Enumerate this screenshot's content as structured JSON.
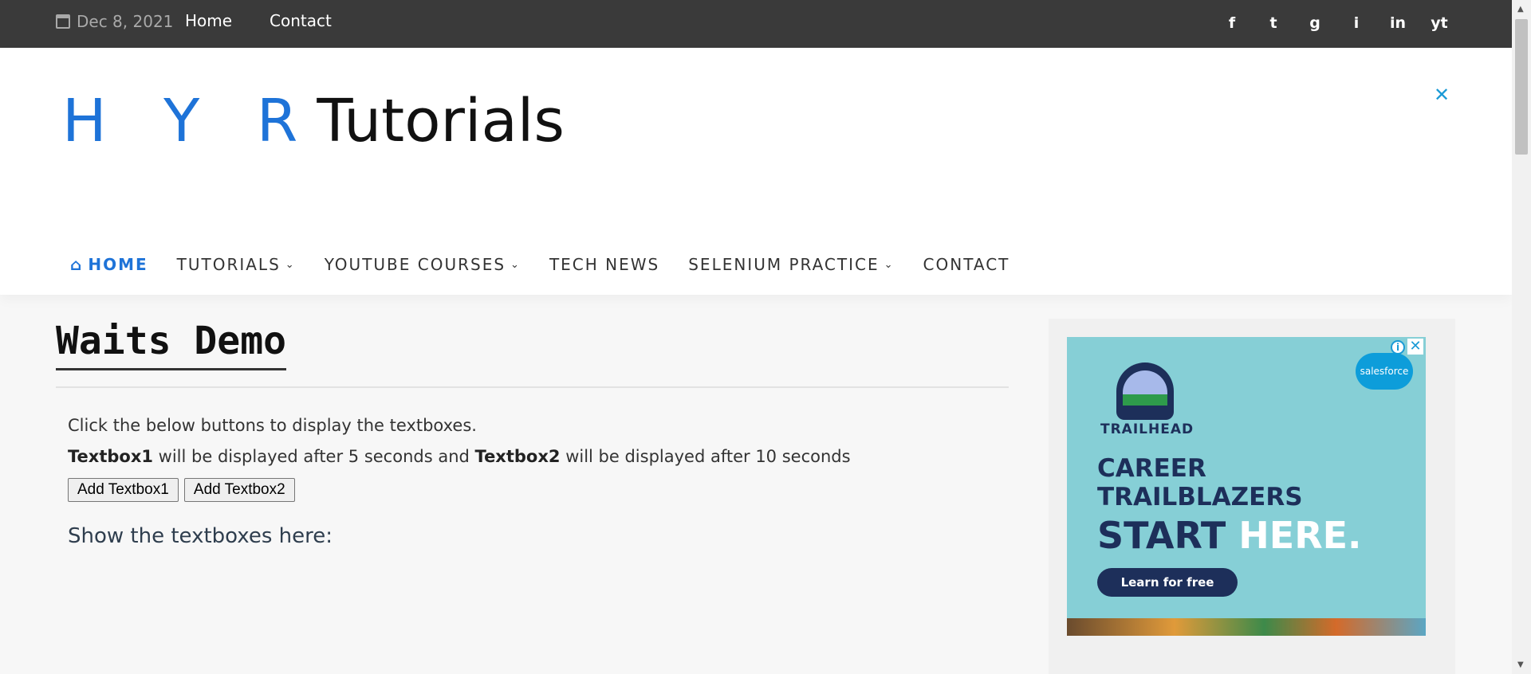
{
  "topbar": {
    "date": "Dec 8, 2021",
    "links": [
      "Home",
      "Contact"
    ],
    "social": [
      "f",
      "t",
      "g",
      "i",
      "in",
      "yt"
    ]
  },
  "header": {
    "logo_blue": "H Y R",
    "logo_black": "Tutorials",
    "ad_close": "✕"
  },
  "nav": {
    "items": [
      {
        "label": "HOME",
        "active": true
      },
      {
        "label": "TUTORIALS",
        "dropdown": true
      },
      {
        "label": "YOUTUBE COURSES",
        "dropdown": true
      },
      {
        "label": "TECH NEWS"
      },
      {
        "label": "SELENIUM PRACTICE",
        "dropdown": true
      },
      {
        "label": "CONTACT"
      }
    ]
  },
  "main": {
    "title": "Waits Demo",
    "instruction": "Click the below buttons to display the textboxes.",
    "desc_bold1": "Textbox1",
    "desc_mid": " will be displayed after 5 seconds and ",
    "desc_bold2": "Textbox2",
    "desc_end": " will be displayed after 10 seconds",
    "btn1": "Add Textbox1",
    "btn2": "Add Textbox2",
    "show_label": "Show the textboxes here:"
  },
  "ad": {
    "brand": "TRAILHEAD",
    "salesforce": "salesforce",
    "headline1": "CAREER",
    "headline2": "TRAILBLAZERS",
    "headline3a": "START",
    "headline3b": "HERE.",
    "cta": "Learn for free"
  },
  "colors": {
    "accent": "#1e73d8",
    "topbar": "#3a3a3a",
    "ad_bg": "#86cfd6"
  }
}
